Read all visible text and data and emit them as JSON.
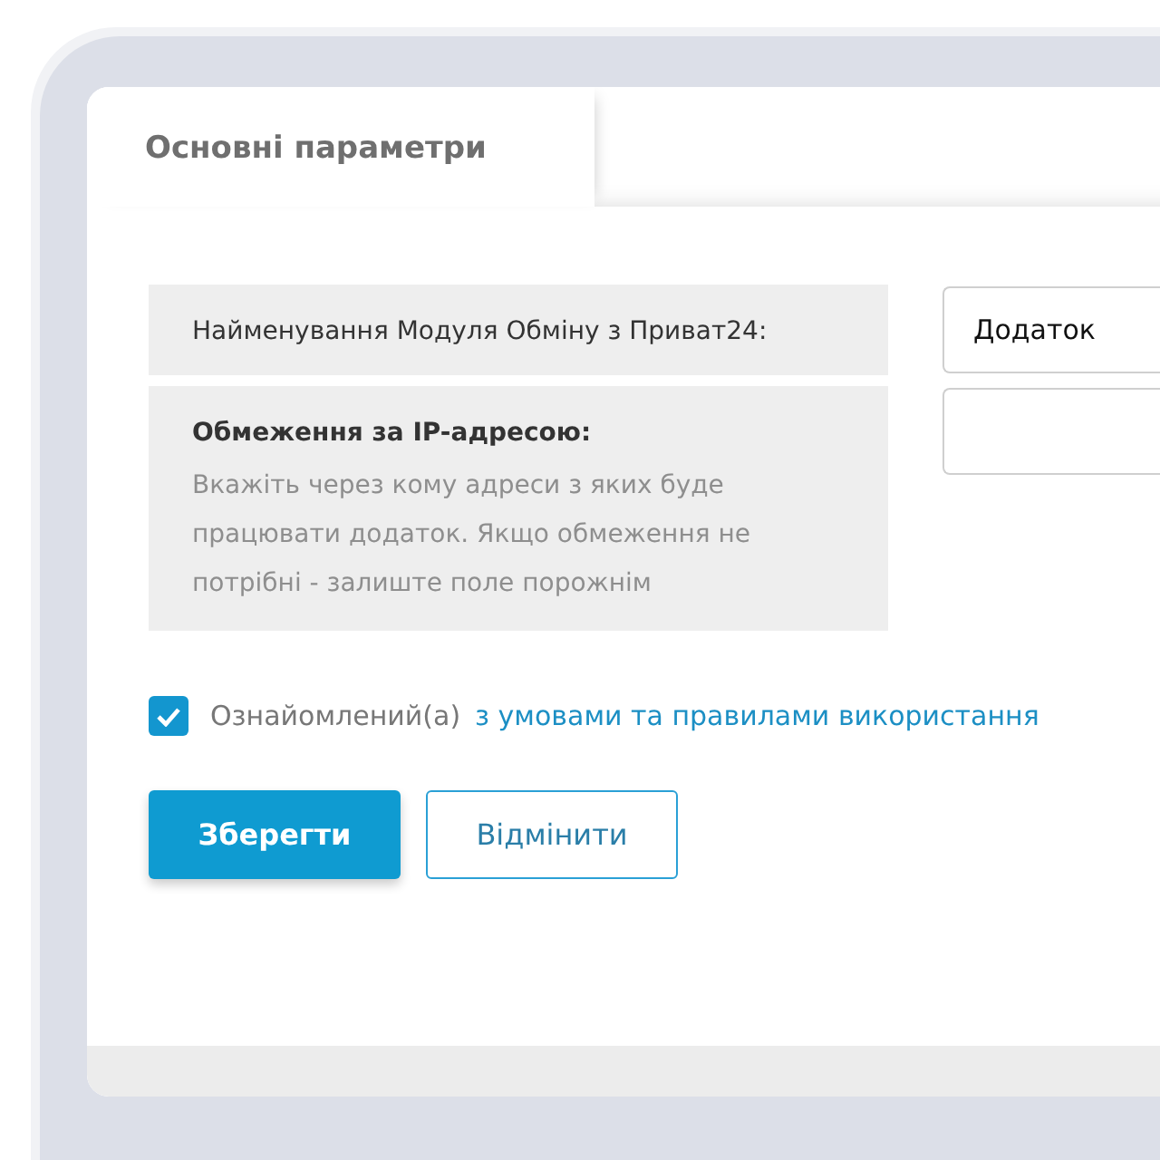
{
  "tabs": [
    {
      "label": "Основні параметри",
      "selected": true
    }
  ],
  "fields": [
    {
      "kind": "plain",
      "label": "Найменування Модуля Обміну з Приват24:",
      "value": "Додаток"
    },
    {
      "kind": "described",
      "label": "Обмеження за IP-адресою:",
      "description": "Вкажіть через кому адреси з яких буде працювати додаток. Якщо обмеження не потрібні - залиште поле порожнім"
    }
  ],
  "agreement": {
    "checked": true,
    "text": "Ознайомлений(а)",
    "link": "з умовами та правилами використання"
  },
  "buttons": [
    {
      "kind": "primary",
      "label": "Зберегти"
    },
    {
      "kind": "secondary",
      "label": "Відмінити"
    }
  ]
}
